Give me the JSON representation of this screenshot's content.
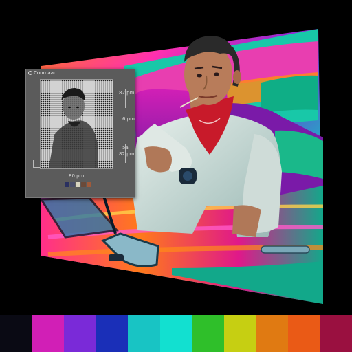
{
  "inset": {
    "title": "Conmaac",
    "label_top": "82 pm",
    "label_mid": "6 pm",
    "label_lower": "82 pm",
    "label_lower_b": "5a",
    "label_bottom": "80 pm",
    "swatch_colors": [
      "#2a3060",
      "#4a4e6a",
      "#d8d4c0",
      "#6a4a3a",
      "#a05a3a"
    ]
  },
  "palette": {
    "colors": [
      "#0a0a14",
      "#d11fb6",
      "#7a2ad8",
      "#1a2fb8",
      "#18c4c4",
      "#12e0d0",
      "#2fbf2a",
      "#c6cf12",
      "#e07a12",
      "#ea5a16",
      "#9a1040"
    ]
  }
}
